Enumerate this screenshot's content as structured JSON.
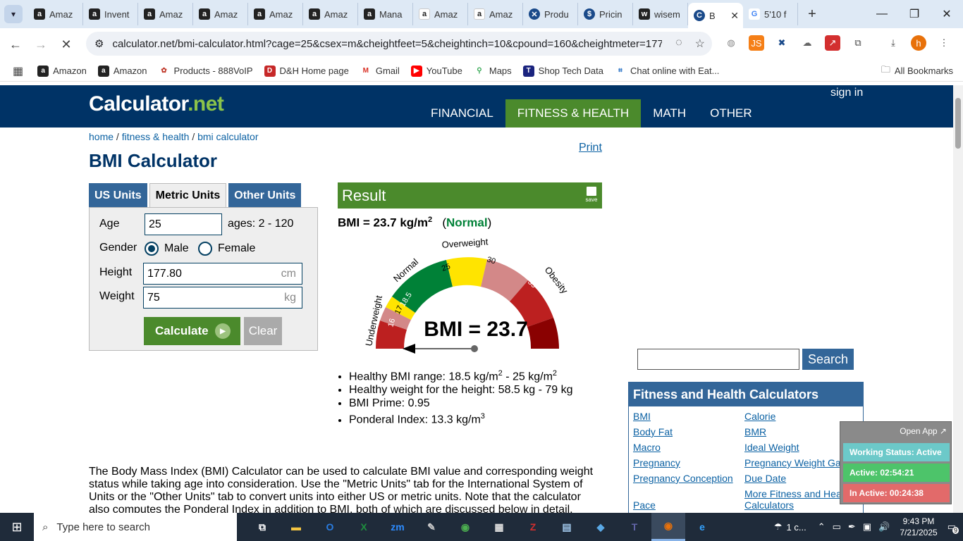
{
  "browser": {
    "tabs": [
      {
        "label": "Amaz",
        "icon": "amazon-a-icon"
      },
      {
        "label": "Invent",
        "icon": "amazon-a-icon"
      },
      {
        "label": "Amaz",
        "icon": "amazon-a-icon"
      },
      {
        "label": "Amaz",
        "icon": "amazon-a-icon"
      },
      {
        "label": "Amaz",
        "icon": "amazon-a-icon"
      },
      {
        "label": "Amaz",
        "icon": "amazon-a-icon"
      },
      {
        "label": "Mana",
        "icon": "amazon-a-icon"
      },
      {
        "label": "Amaz",
        "icon": "amazon-smile-icon"
      },
      {
        "label": "Amaz",
        "icon": "amazon-smile-icon"
      },
      {
        "label": "Produ",
        "icon": "blue-x-icon"
      },
      {
        "label": "Pricin",
        "icon": "blue-dollar-icon"
      },
      {
        "label": "wisem",
        "icon": "wm-icon"
      },
      {
        "label": "B",
        "icon": "calculator-net-icon",
        "active": true
      },
      {
        "label": "5'10 f",
        "icon": "google-icon"
      }
    ],
    "url": "calculator.net/bmi-calculator.html?cage=25&csex=m&cheightfeet=5&cheightinch=10&cpound=160&cheightmeter=177.80...",
    "bookmarks": [
      {
        "label": "Amazon",
        "icon": "amazon-icon"
      },
      {
        "label": "Amazon",
        "icon": "amazon-icon"
      },
      {
        "label": "Products - 888VoIP",
        "icon": "888voip-icon"
      },
      {
        "label": "D&H Home page",
        "icon": "dh-icon"
      },
      {
        "label": "Gmail",
        "icon": "gmail-icon"
      },
      {
        "label": "YouTube",
        "icon": "youtube-icon"
      },
      {
        "label": "Maps",
        "icon": "maps-icon"
      },
      {
        "label": "Shop Tech Data",
        "icon": "techdata-icon"
      },
      {
        "label": "Chat online with Eat...",
        "icon": "chat-icon"
      }
    ],
    "all_bookmarks": "All Bookmarks",
    "profile_initial": "h"
  },
  "site": {
    "logo_main": "Calculator",
    "logo_dot": ".",
    "logo_net": "net",
    "nav": [
      "FINANCIAL",
      "FITNESS & HEALTH",
      "MATH",
      "OTHER"
    ],
    "signin": "sign in",
    "breadcrumb": {
      "home": "home",
      "sep1": " / ",
      "fitness": "fitness & health",
      "sep2": " / ",
      "current": "bmi calculator"
    },
    "print": "Print",
    "title": "BMI Calculator"
  },
  "calculator": {
    "unit_tabs": [
      "US Units",
      "Metric Units",
      "Other Units"
    ],
    "age_label": "Age",
    "age_value": "25",
    "age_hint": "ages: 2 - 120",
    "gender_label": "Gender",
    "male": "Male",
    "female": "Female",
    "height_label": "Height",
    "height_value": "177.80",
    "height_unit": "cm",
    "weight_label": "Weight",
    "weight_value": "75",
    "weight_unit": "kg",
    "calculate": "Calculate",
    "clear": "Clear"
  },
  "result": {
    "header": "Result",
    "save": "save",
    "bmi_text": "BMI = 23.7 kg/m",
    "bmi_sup": "2",
    "status_open": "(",
    "status": "Normal",
    "status_close": ")",
    "gauge_value": "BMI = 23.7",
    "gauge_labels": [
      "Underweight",
      "Normal",
      "Overweight",
      "Obesity"
    ],
    "gauge_ticks": [
      "16",
      "17",
      "18.5",
      "25",
      "30",
      "35",
      "40"
    ],
    "bullets": {
      "healthy_range_a": "Healthy BMI range: 18.5 kg/m",
      "healthy_range_b": " - 25 kg/m",
      "healthy_weight": "Healthy weight for the height: 58.5 kg - 79 kg",
      "prime": "BMI Prime: 0.95",
      "ponderal": "Ponderal Index: 13.3 kg/m",
      "sup2": "2",
      "sup3": "3"
    }
  },
  "intro": "The Body Mass Index (BMI) Calculator can be used to calculate BMI value and corresponding weight status while taking age into consideration. Use the \"Metric Units\" tab for the International System of Units or the \"Other Units\" tab to convert units into either US or metric units. Note that the calculator also computes the Ponderal Index in addition to BMI, both of which are discussed below in detail.",
  "sidebar": {
    "search": "Search",
    "fh_title": "Fitness and Health Calculators",
    "links_left": [
      "BMI",
      "Body Fat",
      "Macro",
      "Pregnancy",
      "Pregnancy Conception",
      "Pace"
    ],
    "links_right": [
      "Calorie",
      "BMR",
      "Ideal Weight",
      "Pregnancy Weight Gain",
      "Due Date",
      "More Fitness and Health Calculators"
    ]
  },
  "widget": {
    "open_app": "Open App ↗",
    "working": "Working Status: Active",
    "active": "Active: 02:54:21",
    "inactive": "In Active: 00:24:38"
  },
  "taskbar": {
    "search_placeholder": "Type here to search",
    "weather": "1 c...",
    "time": "9:43 PM",
    "date": "7/21/2025",
    "notifications": "9"
  },
  "colors": {
    "header_blue": "#003366",
    "green": "#4b8a2c",
    "tab_blue": "#336699",
    "link": "#0b61a3"
  }
}
